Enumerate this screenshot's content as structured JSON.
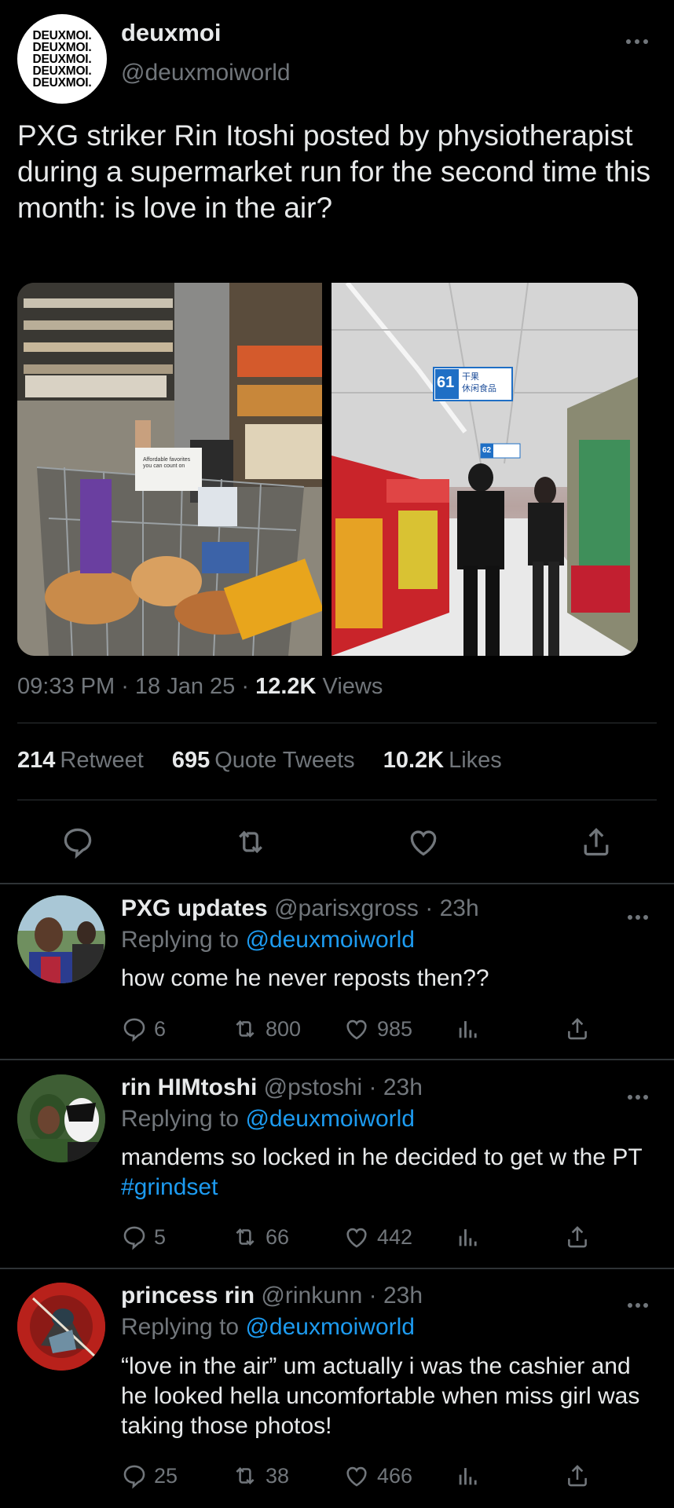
{
  "account": {
    "name": "deuxmoi",
    "handle": "@deuxmoiworld",
    "logo_lines": [
      "DEUXMOI.",
      "DEUXMOI.",
      "DEUXMOI.",
      "DEUXMOI.",
      "DEUXMOI."
    ]
  },
  "tweet": {
    "text": "PXG striker Rin Itoshi posted by physiotherapist during a supermarket run for the second time this month: is love in the air?",
    "time": "09:33 PM",
    "date": "18 Jan 25",
    "views_count": "12.2K",
    "views_label": "Views",
    "retweets_count": "214",
    "retweets_label": "Retweet",
    "quotes_count": "695",
    "quotes_label": "Quote Tweets",
    "likes_count": "10.2K",
    "likes_label": "Likes",
    "photo2_sign_number": "61",
    "photo2_sign_text": "干果\n休闲食品",
    "photo2_sign2": "62",
    "photo1_sign": "Affordable favorites you can count on"
  },
  "more_icon": "more-horizontal-icon",
  "replies": [
    {
      "name": "PXG updates",
      "handle": "@parisxgross",
      "time": "· 23h",
      "replying_prefix": "Replying to",
      "replying_to": "@deuxmoiworld",
      "text": "how come he never reposts then??",
      "hashtag": "",
      "replies": "6",
      "retweets": "800",
      "likes": "985"
    },
    {
      "name": "rin HIMtoshi",
      "handle": "@pstoshi",
      "time": "· 23h",
      "replying_prefix": "Replying to",
      "replying_to": "@deuxmoiworld",
      "text": "mandems so locked in he decided to get w the PT",
      "hashtag": "#grindset",
      "replies": "5",
      "retweets": "66",
      "likes": "442"
    },
    {
      "name": "princess rin",
      "handle": "@rinkunn",
      "time": "· 23h",
      "replying_prefix": "Replying to",
      "replying_to": "@deuxmoiworld",
      "text": "“love in the air” um actually i was the cashier and he looked hella uncomfortable when miss girl was taking those photos!",
      "hashtag": "",
      "replies": "25",
      "retweets": "38",
      "likes": "466"
    }
  ],
  "colors": {
    "background": "#000000",
    "text": "#e7e9ea",
    "muted": "#71767b",
    "link": "#1d9bf0",
    "divider": "#2f3336"
  }
}
